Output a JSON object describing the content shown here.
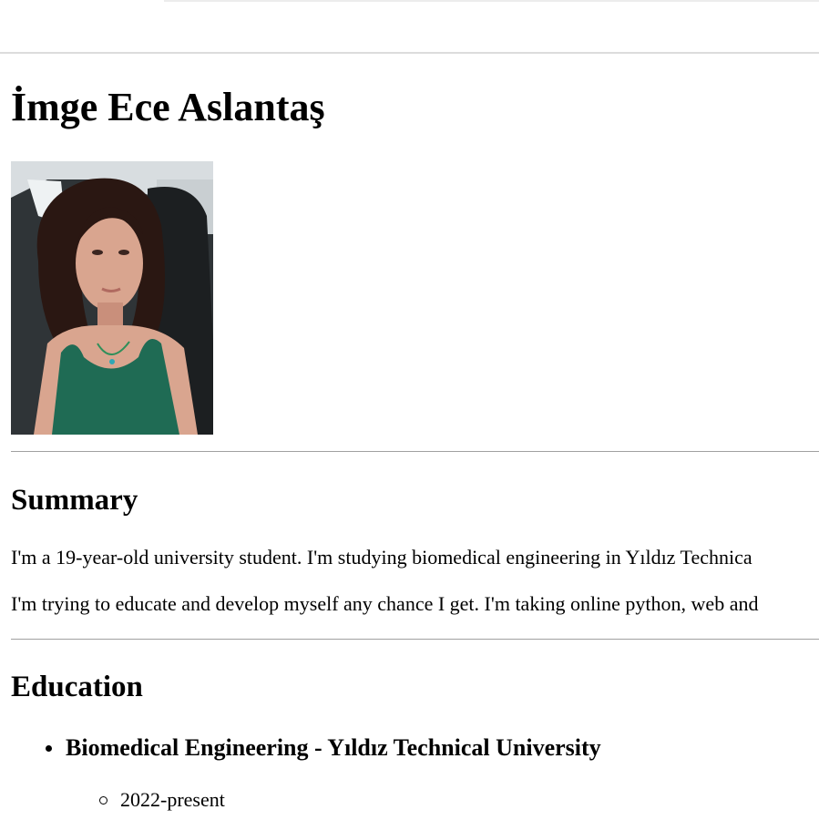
{
  "profile": {
    "name": "İmge Ece Aslantaş",
    "photo_icon": "portrait-photo"
  },
  "summary": {
    "heading": "Summary",
    "paragraph_1": "I'm a 19-year-old university student. I'm studying biomedical engineering in Yıldız Technica",
    "paragraph_2": "I'm trying to educate and develop myself any chance I get. I'm taking online python, web and"
  },
  "education": {
    "heading": "Education",
    "items": [
      {
        "title": "Biomedical Engineering - Yıldız Technical University",
        "years": "2022-present"
      }
    ]
  }
}
